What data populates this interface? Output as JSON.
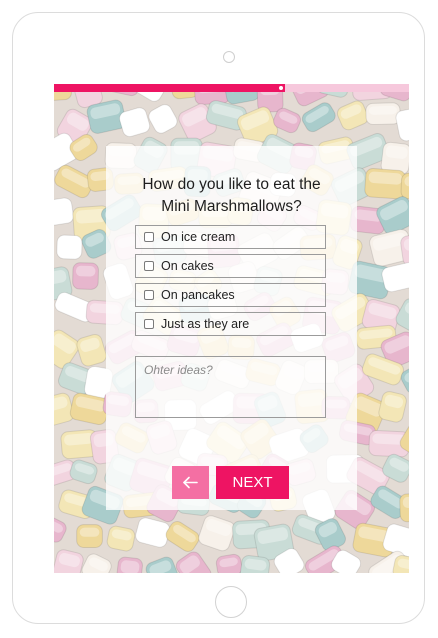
{
  "quiz": {
    "progress": 0.65,
    "question_line1": "How do you like to eat the",
    "question_line2": "Mini Marshmallows?",
    "options": [
      {
        "label": "On ice cream",
        "checked": false
      },
      {
        "label": "On cakes",
        "checked": false
      },
      {
        "label": "On pancakes",
        "checked": false
      },
      {
        "label": "Just as they are",
        "checked": false
      }
    ],
    "ideas_placeholder": "Ohter ideas?",
    "back_icon": "arrow-left-icon",
    "next_label": "NEXT"
  },
  "colors": {
    "accent": "#ee1463",
    "accent_light": "#f46fa3",
    "progress_track": "#f6c8dc"
  }
}
